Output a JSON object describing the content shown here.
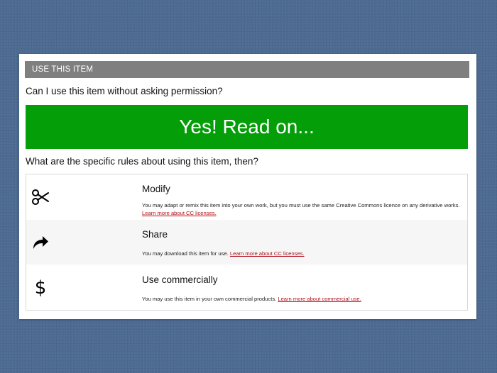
{
  "section": {
    "title": "USE THIS ITEM"
  },
  "permission": {
    "question": "Can I use this item without asking permission?",
    "answer": "Yes! Read on..."
  },
  "rules_question": "What are the specific rules about using this item, then?",
  "rules": [
    {
      "icon": "scissors-icon",
      "title": "Modify",
      "description": "You may adapt or remix this item into your own work, but you must use the same Creative Commons licence on any derivative works.",
      "link": "Learn more about CC licenses."
    },
    {
      "icon": "share-arrow-icon",
      "title": "Share",
      "description": "You may download this item for use.",
      "link": "Learn more about CC licenses."
    },
    {
      "icon": "dollar-icon",
      "title": "Use commercially",
      "description": "You may use this item in your own commercial products.",
      "link": "Learn more about commercial use."
    }
  ],
  "colors": {
    "background": "#4d6a91",
    "section_bar": "#7f7f7f",
    "yes_banner": "#049e08",
    "link": "#b0101a"
  }
}
